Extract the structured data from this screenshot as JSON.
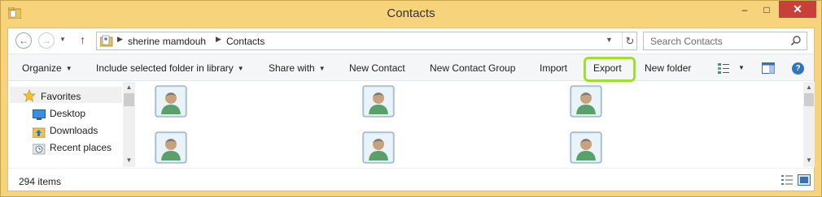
{
  "window": {
    "title": "Contacts",
    "controls": {
      "minimize": "–",
      "maximize": "□",
      "close": "✕"
    }
  },
  "address": {
    "crumbs": [
      "sherine mamdouh",
      "Contacts"
    ],
    "search_placeholder": "Search Contacts"
  },
  "toolbar": {
    "organize": "Organize",
    "include_library": "Include selected folder in library",
    "share_with": "Share with",
    "new_contact": "New Contact",
    "new_contact_group": "New Contact Group",
    "import": "Import",
    "export": "Export",
    "new_folder": "New folder",
    "help": "?"
  },
  "navpane": {
    "favorites": "Favorites",
    "items": [
      "Desktop",
      "Downloads",
      "Recent places"
    ]
  },
  "status": {
    "item_count": "294 items"
  },
  "colors": {
    "frame": "#f7d47c",
    "close_button": "#c7403a",
    "export_highlight": "#9ee02a"
  },
  "icons": [
    "back-icon",
    "forward-icon",
    "up-icon",
    "refresh-icon",
    "search-icon",
    "star-icon",
    "desktop-icon",
    "downloads-icon",
    "recent-places-icon",
    "contact-icon",
    "details-view-icon",
    "large-icons-view-icon",
    "help-icon"
  ]
}
